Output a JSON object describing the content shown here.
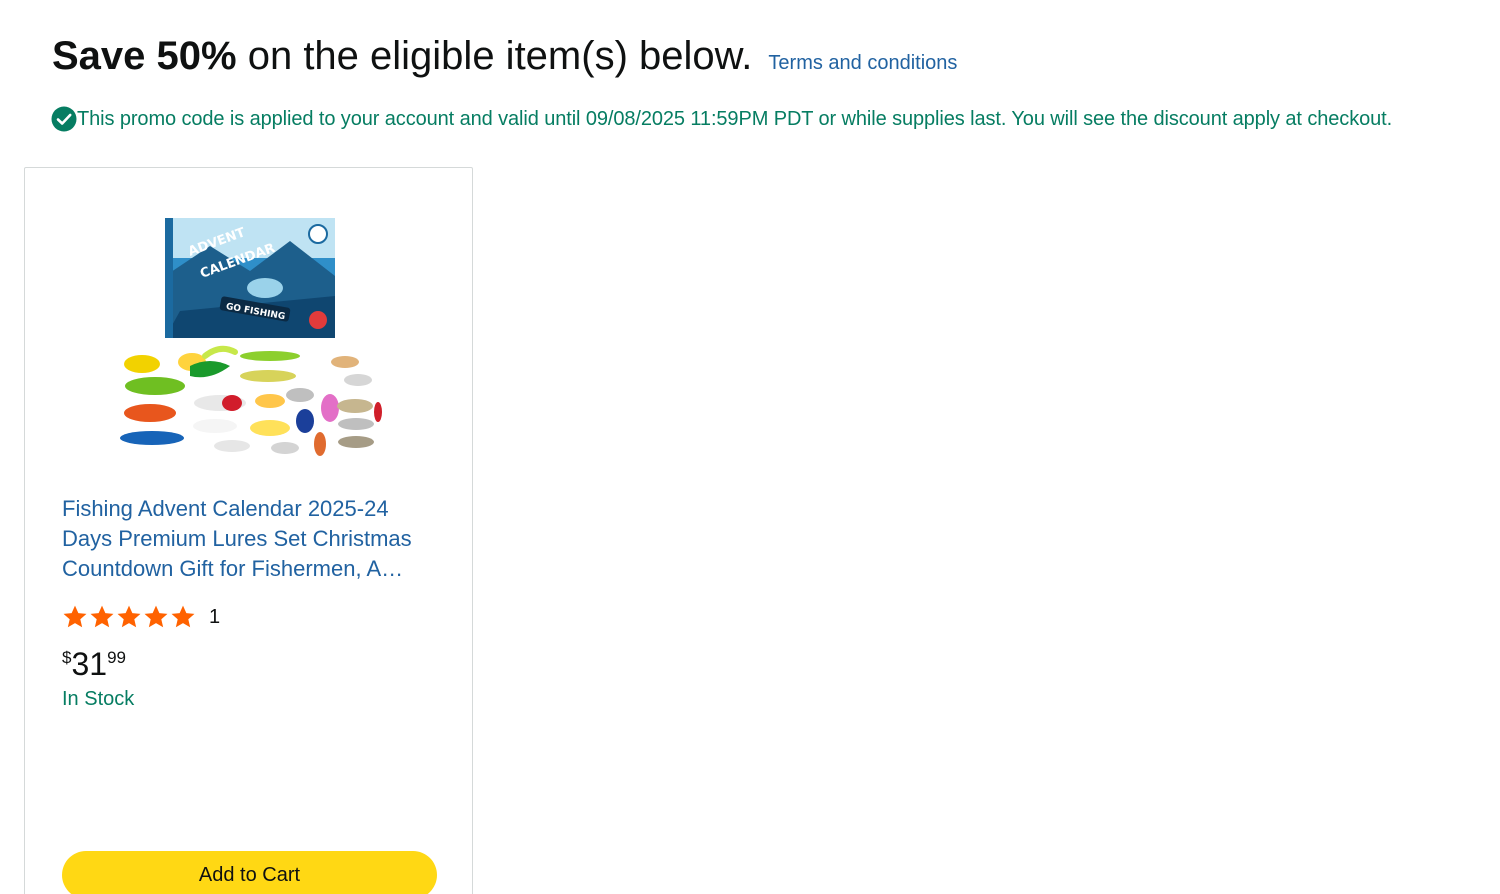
{
  "header": {
    "headline_bold": "Save 50%",
    "headline_rest": " on the eligible item(s) below.",
    "terms_link": "Terms and conditions"
  },
  "promo": {
    "message": "This promo code is applied to your account and valid until 09/08/2025 11:59PM PDT or while supplies last. You will see the discount apply at checkout.",
    "icon": "check-circle-icon",
    "color": "#067d62"
  },
  "product": {
    "image_text": {
      "line1": "ADVENT",
      "line2": "CALENDAR",
      "line3": "GO FISHING"
    },
    "title": "Fishing Advent Calendar 2025-24 Days Premium Lures Set Christmas Countdown Gift for Fishermen, A…",
    "rating_stars": 5,
    "rating_count": "1",
    "price_symbol": "$",
    "price_whole": "31",
    "price_fraction": "99",
    "stock": "In Stock",
    "add_to_cart": "Add to Cart"
  },
  "colors": {
    "link": "#2162a1",
    "success": "#067d62",
    "star": "#ff6200",
    "button": "#ffd814"
  }
}
